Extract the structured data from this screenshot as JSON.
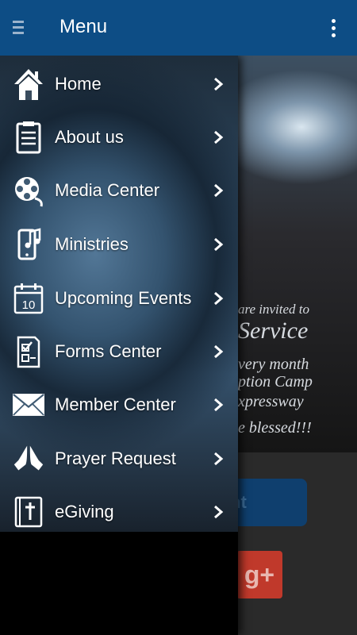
{
  "appbar": {
    "title": "Menu",
    "menu_icon": "hamburger-icon",
    "overflow_icon": "overflow-menu-icon",
    "color": "#0d4d85"
  },
  "drawer": {
    "items": [
      {
        "label": "Home",
        "icon": "home-icon"
      },
      {
        "label": "About us",
        "icon": "clipboard-icon"
      },
      {
        "label": "Media Center",
        "icon": "film-reel-icon"
      },
      {
        "label": "Ministries",
        "icon": "phone-music-icon"
      },
      {
        "label": "Upcoming Events",
        "icon": "calendar-icon"
      },
      {
        "label": "Forms Center",
        "icon": "form-icon"
      },
      {
        "label": "Member Center",
        "icon": "envelope-icon"
      },
      {
        "label": "Prayer Request",
        "icon": "praying-hands-icon"
      },
      {
        "label": "eGiving",
        "icon": "bible-icon"
      }
    ],
    "calendar_day": "10"
  },
  "background": {
    "banner_lines": [
      "are invited to",
      "Service",
      "very month",
      "ption Camp",
      "xpressway",
      "e blessed!!!"
    ],
    "button_partial_text": "nt",
    "gplus_text": "g+"
  }
}
